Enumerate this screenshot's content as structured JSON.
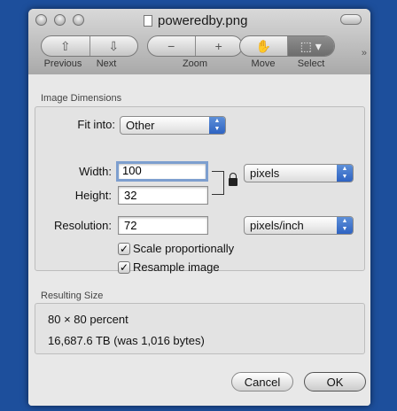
{
  "window": {
    "title": "poweredby.png"
  },
  "toolbar": {
    "previous_label": "Previous",
    "next_label": "Next",
    "zoom_label": "Zoom",
    "move_label": "Move",
    "select_label": "Select"
  },
  "dimensions": {
    "section_label": "Image Dimensions",
    "fit_into_label": "Fit into:",
    "fit_into_value": "Other",
    "width_label": "Width:",
    "width_value": "100",
    "height_label": "Height:",
    "height_value": "32",
    "units_value": "pixels",
    "resolution_label": "Resolution:",
    "resolution_value": "72",
    "resolution_units_value": "pixels/inch",
    "scale_label": "Scale proportionally",
    "scale_checked": true,
    "resample_label": "Resample image",
    "resample_checked": true
  },
  "result": {
    "section_label": "Resulting Size",
    "percent_text": "80 × 80 percent",
    "size_text": "16,687.6 TB (was 1,016 bytes)"
  },
  "buttons": {
    "cancel_label": "Cancel",
    "ok_label": "OK"
  },
  "colors": {
    "desktop": "#1d4f9c",
    "accent": "#2e63c2"
  }
}
